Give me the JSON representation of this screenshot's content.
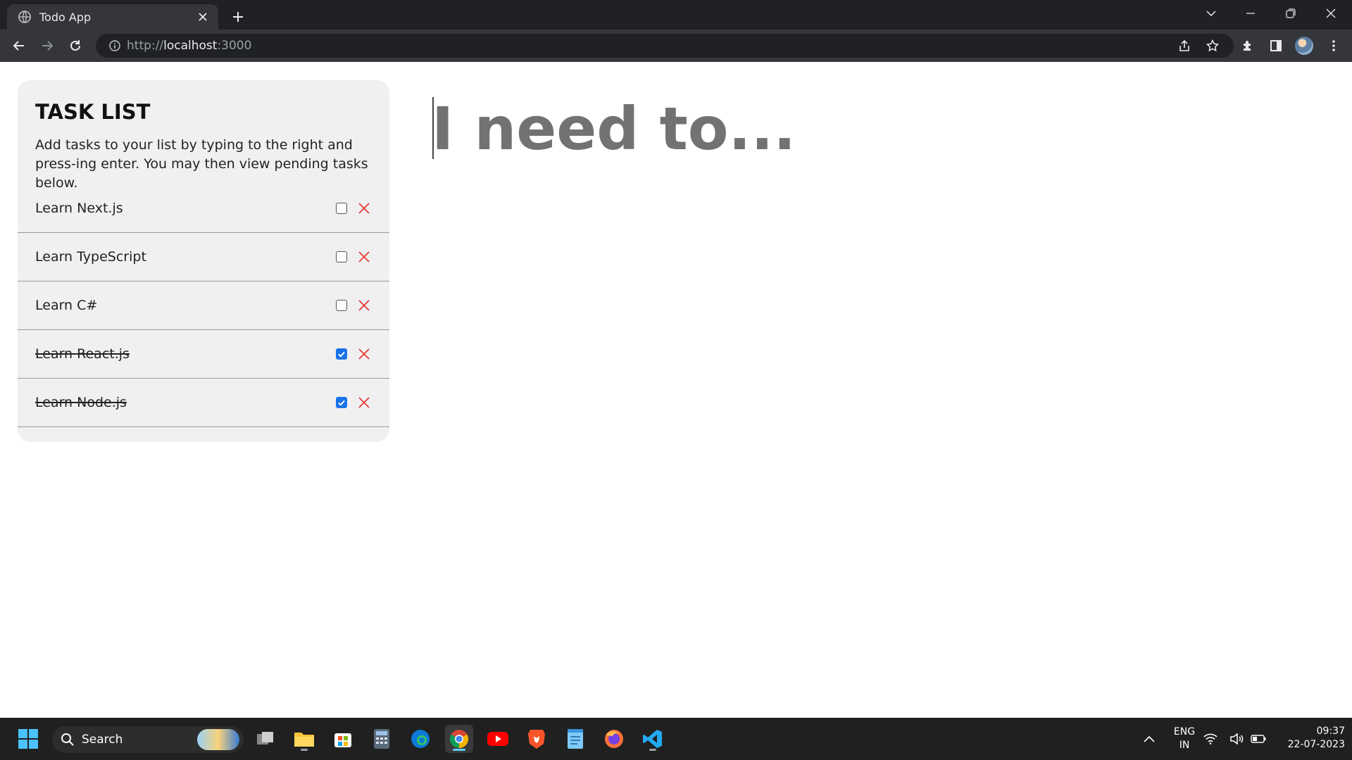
{
  "browser": {
    "tab_title": "Todo App",
    "new_tab_label": "+",
    "url_scheme": "http://",
    "url_host": "localhost",
    "url_port": ":3000"
  },
  "panel": {
    "title": "TASK LIST",
    "description": "Add tasks to your list by typing to the right and press-ing enter. You may then view pending tasks below."
  },
  "tasks": [
    {
      "label": "Learn Next.js",
      "done": false
    },
    {
      "label": "Learn TypeScript",
      "done": false
    },
    {
      "label": "Learn C#",
      "done": false
    },
    {
      "label": "Learn React.js",
      "done": true
    },
    {
      "label": "Learn Node.js",
      "done": true
    }
  ],
  "input": {
    "placeholder": "I need to..."
  },
  "taskbar": {
    "search_label": "Search",
    "language_line1": "ENG",
    "language_line2": "IN",
    "time": "09:37",
    "date": "22-07-2023"
  },
  "colors": {
    "delete_icon": "#e53935",
    "checkbox_checked": "#1a73e8",
    "panel_bg": "#f0f0f0"
  },
  "icons": [
    "globe-icon",
    "close-icon",
    "plus-icon",
    "chevron-down-icon",
    "minimize-icon",
    "restore-icon",
    "window-close-icon",
    "back-icon",
    "forward-icon",
    "reload-icon",
    "info-icon",
    "share-icon",
    "star-icon",
    "extensions-icon",
    "side-panel-icon",
    "menu-icon",
    "windows-start-icon",
    "search-icon",
    "task-view-icon",
    "file-explorer-icon",
    "store-icon",
    "calculator-icon",
    "edge-icon",
    "chrome-icon",
    "youtube-icon",
    "brave-icon",
    "notepad-icon",
    "firefox-icon",
    "vscode-icon",
    "tray-chevron-icon",
    "wifi-icon",
    "volume-icon",
    "battery-icon"
  ]
}
